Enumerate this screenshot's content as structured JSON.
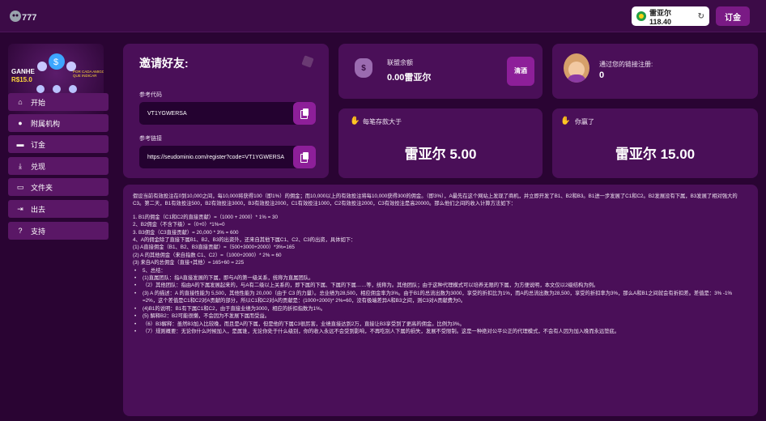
{
  "header": {
    "balance": "雷亚尔 118.40",
    "deposit_label": "订金"
  },
  "sidebar": {
    "promo": {
      "ganhe": "GANHE",
      "amount": "R$15.0",
      "sub": "POR CADA AMIGO QUE INDICAR"
    },
    "items": [
      {
        "label": "开始",
        "icon": "home-icon"
      },
      {
        "label": "附属机构",
        "icon": "users-icon"
      },
      {
        "label": "订金",
        "icon": "wallet-icon"
      },
      {
        "label": "兑现",
        "icon": "withdraw-icon"
      },
      {
        "label": "文件夹",
        "icon": "folder-icon"
      },
      {
        "label": "出去",
        "icon": "logout-icon"
      },
      {
        "label": "支持",
        "icon": "support-icon"
      }
    ]
  },
  "invite": {
    "title": "邀请好友:",
    "code_label": "参考代码",
    "code_value": "VT1YGWERSA",
    "link_label": "参考链接",
    "link_value": "https://seudominio.com/register?code=VT1YGWERSA"
  },
  "alliance": {
    "label": "联盟余额",
    "value": "0.00雷亚尔",
    "claim_label": "清酒"
  },
  "registered": {
    "label": "通过您的链接注册:",
    "value": "0"
  },
  "deposit_more": {
    "label": "每笔存款大于",
    "value": "雷亚尔 5.00"
  },
  "you_earn": {
    "label": "你赢了",
    "value": "雷亚尔 15.00"
  },
  "explanation": {
    "intro": "假设当前有效投注在0到10,000之间，每10,000将获得100（即1%）的佣金；而10,000以上的有效投注将每10,000获得300的佣金。（即3%），A最先在这个网站上发现了商机，并立即开发了B1、B2和B3。B1进一步发展了C1和C2。B2发展没有下属，B3发展了相对强大的C3。第二天，B1有效投注500，B2有效投注3000，B3有效投注2000，C1有效投注1000，C2有效投注2000，C3有效投注是高20000。那么他们之间的收入计算方法如下：",
    "lines": [
      "1. B1的佣金（C1和C2的直接贡献）=（1000 + 2000）* 1% = 30",
      "2、B2佣金（不含下级）=（0+0）*1%=0",
      "3. B3佣金（C3直接贡献）= 20,000 * 3% = 600",
      "4、A的佣金除了直接下属B1、B2、B3的出资外，还来自其他下属C1、C2、C3的出资，具体如下：",
      "(1) A直接佣金（B1、B2、B3直接贡献）=（500+3000+2000）*3%=165",
      "(2) A 的其他佣金（来自指数 C1、C2）=（1000+2000）* 2% = 60",
      "(3) 来自A的总佣金（直接+其他）= 165+60 = 225"
    ],
    "bullets": [
      "5、总结：",
      "(1)直属团队：指A直接发展的下属，即与A的第一级关系，统称为直属团队。",
      "（2）其他团队：指由A的下属发展起来的，与A有二级以上关系的，即下属的下属、下属的下属……等，统称为。其他团队；由于这种代理模式可以培养无限的下属，为方便说明，本文仅以2级结构为例。",
      "(3) A 的描述：A 的直接性能为 5,500，其他性能为 20,000（由于 C3 的力量）。总业绩为28,500，相应佣金率为3%。由于B1的总流出数为3000，享受的折扣比为1%，而A的总流出数为28,500，享受的折扣率为3%，那么A和B1之间就会有折扣差。差值是：3% -1% =2%，这个差值是C1和C2对A贡献的部分，所以C1和C2对A的贡献是：(1000+2000)* 2%=60，没有极端差异A和B3之间，则C3对A贡献费为0。",
      "(4)B1的说明：B1有下属C1和C2，由于直接业绩为3000，相应的折扣指数为1%。",
      "(5) 解释B2：B2可能很懒，不会因为不发展下属而受益。",
      "（6）B3解释：虽然B3加入比较晚，而且是A的下属，但是他的下属C3很厉害，业绩直接达到2万，直接让B3享受到了更高的佣金。比例为3%。",
      "（7）规则概要：无论你什么时候加入，是属谁，无论你处于什么级别，你的收入永远不会受到影响，不再吃别人下属的损失，发展不受限制。这是一种绝对公平公正的代理模式，不会有人因为加入晚而永远垫底。"
    ]
  },
  "colors": {
    "background": "#2a0433",
    "card": "#4a0f58",
    "accent": "#8d1f99",
    "nav": "#5a1766"
  }
}
